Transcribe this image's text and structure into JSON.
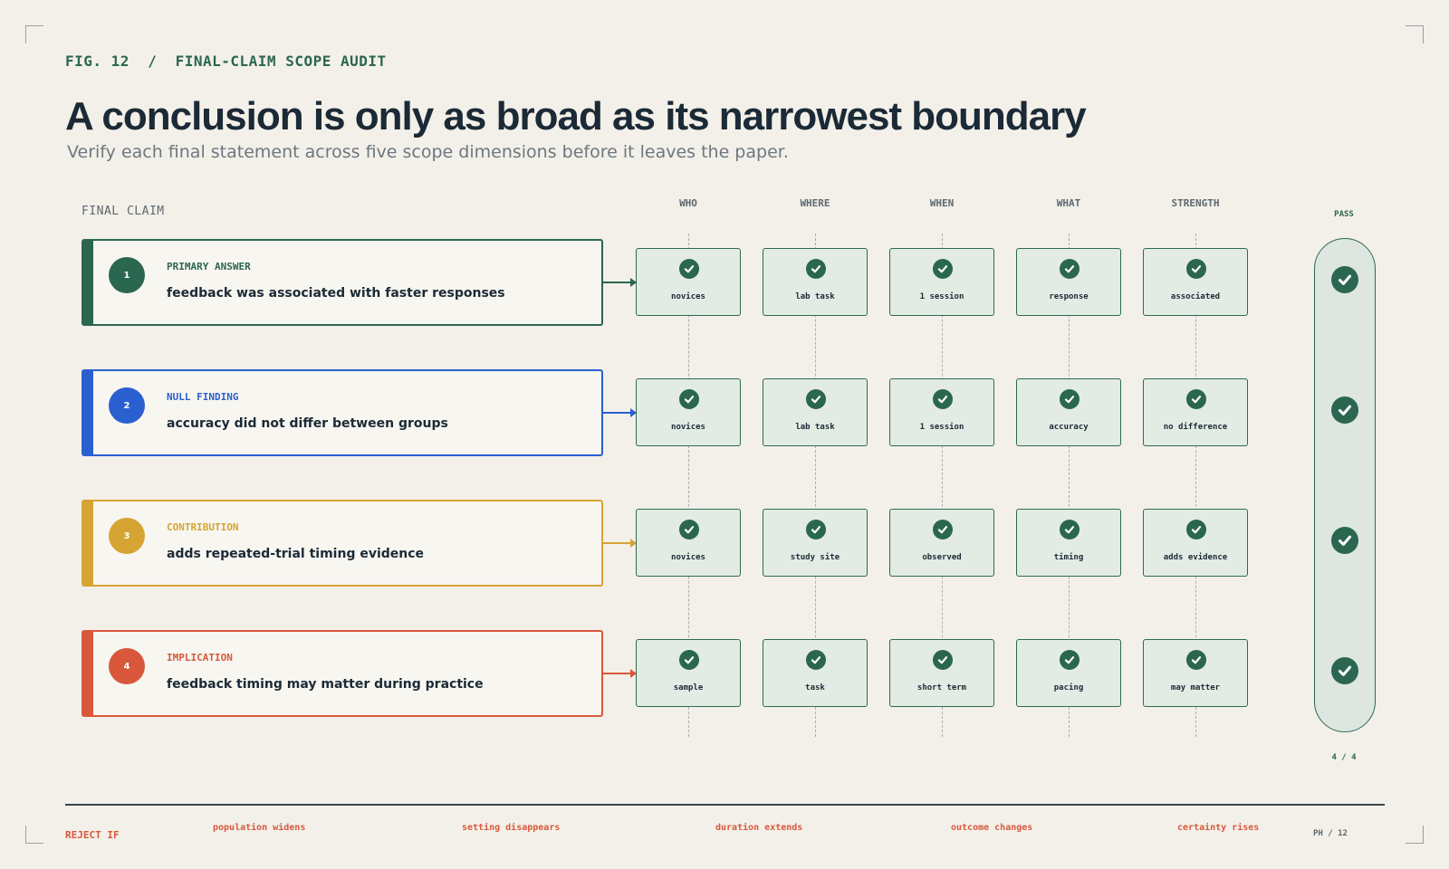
{
  "figure": {
    "label": "FIG. 12  /  FINAL-CLAIM SCOPE AUDIT"
  },
  "header": {
    "title": "A conclusion is only as broad as its narrowest boundary",
    "subtitle": "Verify each final statement across five scope dimensions before it leaves the paper."
  },
  "final_claim_label": "FINAL CLAIM",
  "dimensions": [
    "WHO",
    "WHERE",
    "WHEN",
    "WHAT",
    "STRENGTH"
  ],
  "pass_label": "PASS",
  "claims": [
    {
      "number": "1",
      "kind": "PRIMARY ANSWER",
      "text": "feedback was associated with faster responses",
      "color": "#2b6650",
      "cells": [
        "novices",
        "lab task",
        "1 session",
        "response",
        "associated"
      ]
    },
    {
      "number": "2",
      "kind": "NULL FINDING",
      "text": "accuracy did not differ between groups",
      "color": "#2a5fd0",
      "cells": [
        "novices",
        "lab task",
        "1 session",
        "accuracy",
        "no difference"
      ]
    },
    {
      "number": "3",
      "kind": "CONTRIBUTION",
      "text": "adds repeated-trial timing evidence",
      "color": "#d6a432",
      "cells": [
        "novices",
        "study site",
        "observed",
        "timing",
        "adds evidence"
      ]
    },
    {
      "number": "4",
      "kind": "IMPLICATION",
      "text": "feedback timing may matter during practice",
      "color": "#d9583c",
      "cells": [
        "sample",
        "task",
        "short term",
        "pacing",
        "may matter"
      ]
    }
  ],
  "pass_count": "4 / 4",
  "reject": {
    "label": "REJECT IF",
    "items": [
      "population widens",
      "setting disappears",
      "duration extends",
      "outcome changes",
      "certainty rises"
    ]
  },
  "page": "PH / 12",
  "icons": {
    "check": "check-circle-icon"
  }
}
